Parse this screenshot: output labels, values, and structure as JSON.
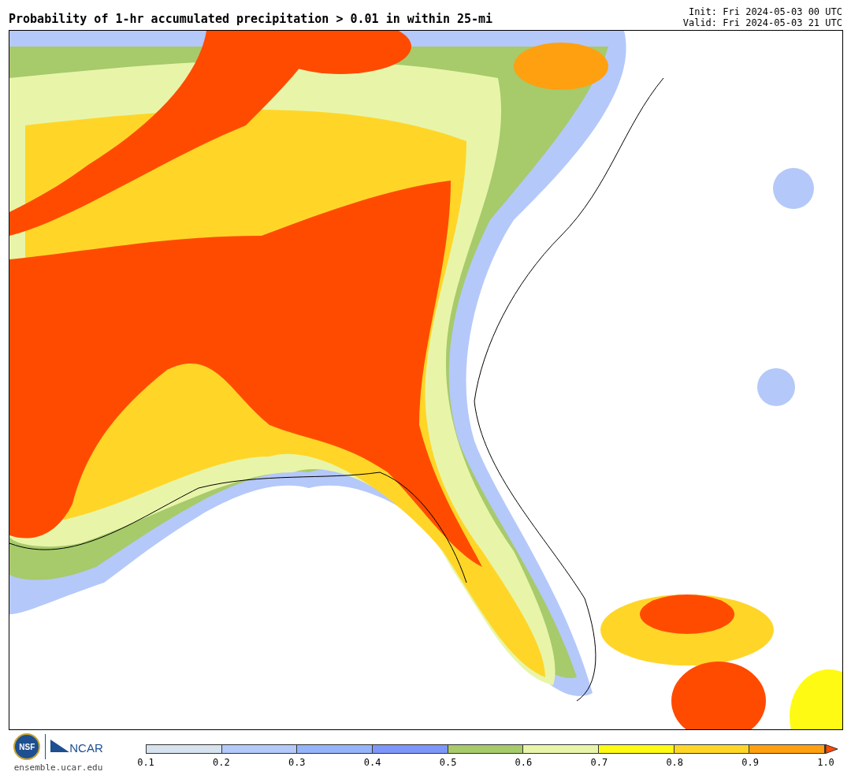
{
  "title": "Probability of 1-hr accumulated precipitation > 0.01 in within 25-mi",
  "init": "Init: Fri 2024-05-03 00 UTC",
  "valid": "Valid: Fri 2024-05-03 21 UTC",
  "logos": {
    "nsf": "NSF",
    "ncar": "NCAR",
    "url": "ensemble.ucar.edu"
  },
  "colorbar": {
    "bins": [
      {
        "color": "#d6e2ee"
      },
      {
        "color": "#b4c8fa"
      },
      {
        "color": "#96b4fa"
      },
      {
        "color": "#7d96fa"
      },
      {
        "color": "#a7ca6b"
      },
      {
        "color": "#e8f5a9"
      },
      {
        "color": "#fffa14"
      },
      {
        "color": "#ffd628"
      },
      {
        "color": "#ffa010"
      }
    ],
    "extension": {
      "color": "#ff4b00"
    },
    "labels": [
      "0.1",
      "0.2",
      "0.3",
      "0.4",
      "0.5",
      "0.6",
      "0.7",
      "0.8",
      "0.9",
      "1.0"
    ]
  }
}
